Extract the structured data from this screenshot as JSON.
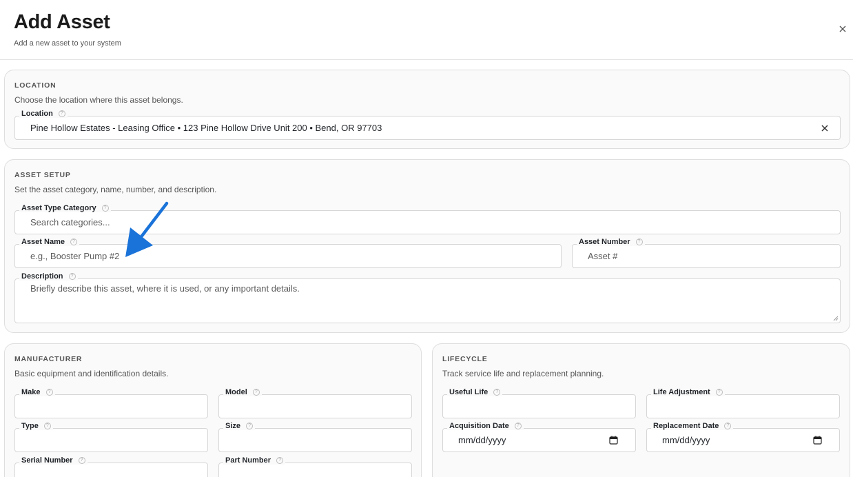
{
  "header": {
    "title": "Add Asset",
    "subtitle": "Add a new asset to your system",
    "close_icon": "close-icon"
  },
  "location": {
    "title": "LOCATION",
    "description": "Choose the location where this asset belongs.",
    "field_label": "Location",
    "value": "Pine Hollow Estates - Leasing Office • 123 Pine Hollow Drive Unit 200 • Bend, OR 97703"
  },
  "asset_setup": {
    "title": "ASSET SETUP",
    "description": "Set the asset category, name, number, and description.",
    "category_label": "Asset Type Category",
    "category_placeholder": "Search categories...",
    "name_label": "Asset Name",
    "name_placeholder": "e.g., Booster Pump #2",
    "number_label": "Asset Number",
    "number_placeholder": "Asset #",
    "description_label": "Description",
    "description_placeholder": "Briefly describe this asset, where it is used, or any important details."
  },
  "manufacturer": {
    "title": "MANUFACTURER",
    "description": "Basic equipment and identification details.",
    "make_label": "Make",
    "model_label": "Model",
    "type_label": "Type",
    "size_label": "Size",
    "serial_label": "Serial Number",
    "part_label": "Part Number"
  },
  "lifecycle": {
    "title": "LIFECYCLE",
    "description": "Track service life and replacement planning.",
    "useful_life_label": "Useful Life",
    "life_adjustment_label": "Life Adjustment",
    "acquisition_label": "Acquisition Date",
    "acquisition_value": "mm/dd/yyyy",
    "replacement_label": "Replacement Date",
    "replacement_value": "mm/dd/yyyy"
  },
  "help_glyph": "?",
  "colors": {
    "arrow": "#1a73d9",
    "card_bg": "#fafafa",
    "border": "#dedede"
  }
}
